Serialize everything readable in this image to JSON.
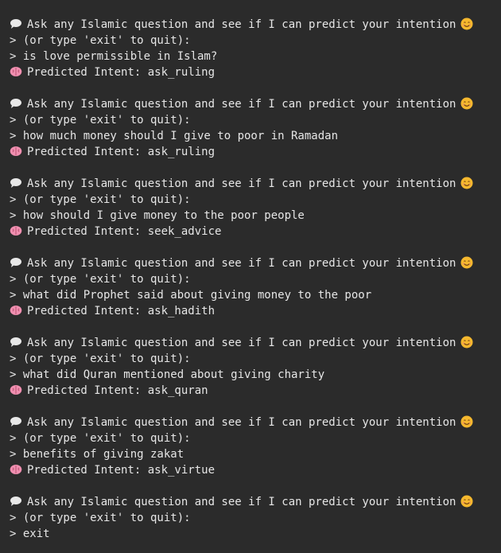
{
  "prompt": {
    "text": "Ask any Islamic question and see if I can predict your intention",
    "quit_hint": "> (or type 'exit' to quit):",
    "prediction_prefix": "Predicted Intent: "
  },
  "icons": {
    "prompt": "speech-balloon-icon",
    "smiley": "smiling-face-icon",
    "prediction": "brain-icon"
  },
  "colors": {
    "background": "#2b2b2b",
    "text": "#e6e6e6",
    "brain": "#f08fb0",
    "smiley": "#f5b82e"
  },
  "exchanges": [
    {
      "input": "> is love permissible in Islam?",
      "intent": "ask_ruling"
    },
    {
      "input": "> how much money should I give to poor in Ramadan",
      "intent": "ask_ruling"
    },
    {
      "input": "> how should I give money to the poor people",
      "intent": "seek_advice"
    },
    {
      "input": "> what did Prophet said about giving money to the poor",
      "intent": "ask_hadith"
    },
    {
      "input": "> what did Quran mentioned about giving charity",
      "intent": "ask_quran"
    },
    {
      "input": "> benefits of giving zakat",
      "intent": "ask_virtue"
    },
    {
      "input": "> exit",
      "intent": null
    }
  ]
}
